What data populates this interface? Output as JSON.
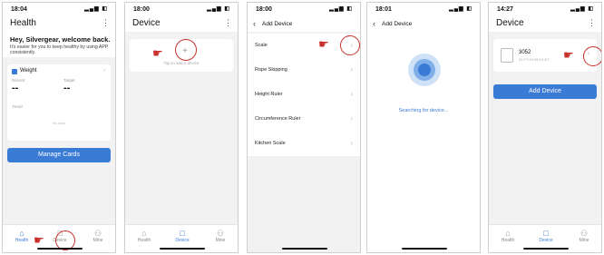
{
  "screens": [
    {
      "time": "18:04",
      "title": "Health",
      "greeting": "Hey, Silvergear, welcome back.",
      "subtitle": "It's easier for you to keep healthy by using APP consistently.",
      "weight_card": {
        "title": "Weight",
        "recent_label": "Recent",
        "target_label": "Target",
        "recent_value": "--",
        "target_value": "--",
        "trend_label": "Trend",
        "no_data": "No data"
      },
      "manage_button": "Manage Cards",
      "tabs": [
        {
          "icon": "⌂",
          "label": "Health"
        },
        {
          "icon": "□",
          "label": "Device"
        },
        {
          "icon": "⚇",
          "label": "Mine"
        }
      ]
    },
    {
      "time": "18:00",
      "title": "Device",
      "add_symbol": "+",
      "add_hint": "Tap to add a device",
      "tabs": [
        {
          "icon": "⌂",
          "label": "Health"
        },
        {
          "icon": "□",
          "label": "Device"
        },
        {
          "icon": "⚇",
          "label": "Mine"
        }
      ]
    },
    {
      "time": "18:00",
      "title": "Add Device",
      "items": [
        "Scale",
        "Rope Skipping",
        "Height Ruler",
        "Circumference Ruler",
        "Kitchen Scale"
      ]
    },
    {
      "time": "18:01",
      "title": "Add Device",
      "searching": "Searching for device..."
    },
    {
      "time": "14:27",
      "title": "Device",
      "device_name": "3052",
      "device_id": "01:F7:42:93:D1:E7",
      "add_button": "Add Device",
      "tabs": [
        {
          "icon": "⌂",
          "label": "Health"
        },
        {
          "icon": "□",
          "label": "Device"
        },
        {
          "icon": "⚇",
          "label": "Mine"
        }
      ]
    }
  ],
  "colors": {
    "accent": "#3a7bd5",
    "pointer": "#c7302b"
  }
}
